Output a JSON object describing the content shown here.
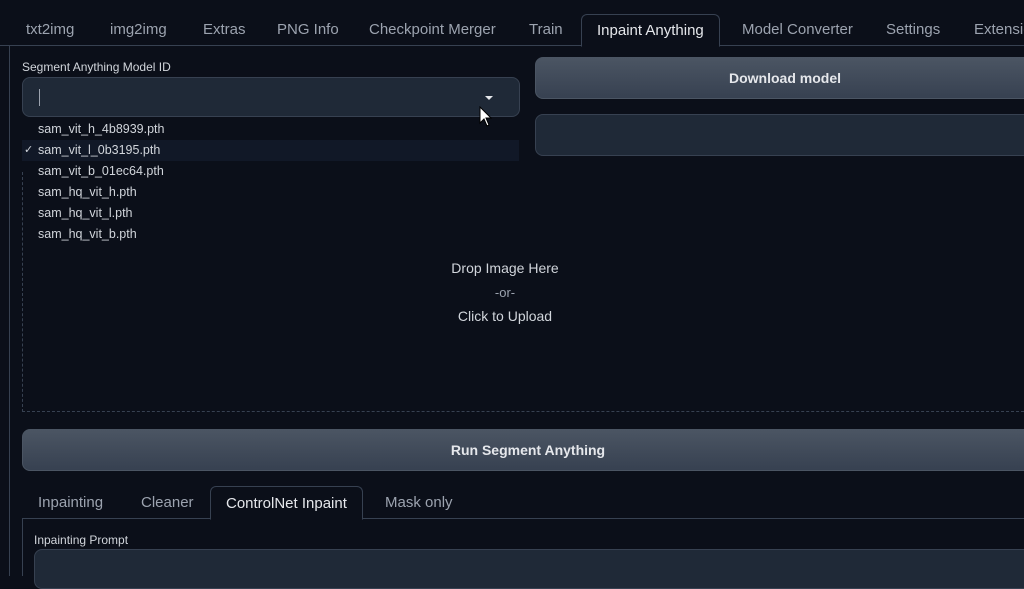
{
  "tabs": [
    "txt2img",
    "img2img",
    "Extras",
    "PNG Info",
    "Checkpoint Merger",
    "Train",
    "Inpaint Anything",
    "Model Converter",
    "Settings",
    "Extensions"
  ],
  "model": {
    "label": "Segment Anything Model ID",
    "value": "",
    "options": [
      "sam_vit_h_4b8939.pth",
      "sam_vit_l_0b3195.pth",
      "sam_vit_b_01ec64.pth",
      "sam_hq_vit_h.pth",
      "sam_hq_vit_l.pth",
      "sam_hq_vit_b.pth"
    ],
    "checkmark": "✓"
  },
  "download_button": "Download model",
  "upload": {
    "drop": "Drop Image Here",
    "or": "-or-",
    "click": "Click to Upload"
  },
  "run_button": "Run Segment Anything",
  "subtabs": [
    "Inpainting",
    "Cleaner",
    "ControlNet Inpaint",
    "Mask only"
  ],
  "prompt_label": "Inpainting Prompt"
}
